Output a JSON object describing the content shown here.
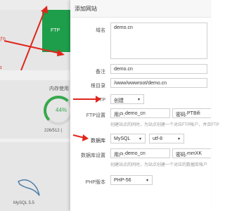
{
  "background": {
    "ftp_tile_label": "FTP",
    "memory_label": "内存使用",
    "memory_percent": "44%",
    "memory_detail": "226/512 (",
    "mysql_label": "MySQL 5.5",
    "red_text_1": "ƒn",
    "red_text_2": "ɪ"
  },
  "modal": {
    "title": "添加网站",
    "domain_label": "域名",
    "domain_value": "demo.cn",
    "remark_label": "备注",
    "remark_value": "demo.cn",
    "root_label": "根目录",
    "root_value": "/www/wwwroot/demo.cn",
    "ftp_label": "FTP",
    "ftp_select": "创建",
    "ftp_settings_label": "FTP设置",
    "ftp_user_label": "用户:",
    "ftp_user_value": "demo_cn",
    "ftp_pass_label": "密码:",
    "ftp_pass_value": "PTBifi",
    "ftp_help": "创建站点的同时，为站点创建一个对应FTP帐户，并且FTP",
    "db_label": "数据库",
    "db_select": "MySQL",
    "db_charset": "utf-8",
    "db_settings_label": "数据库设置",
    "db_user_label": "用户:",
    "db_user_value": "demo_cn",
    "db_pass_label": "密码:",
    "db_pass_value": "mmXK",
    "db_help": "创建站点的同时，为站点创建一个对应的数据库帐户",
    "php_label": "PHP版本",
    "php_value": "PHP-56"
  }
}
